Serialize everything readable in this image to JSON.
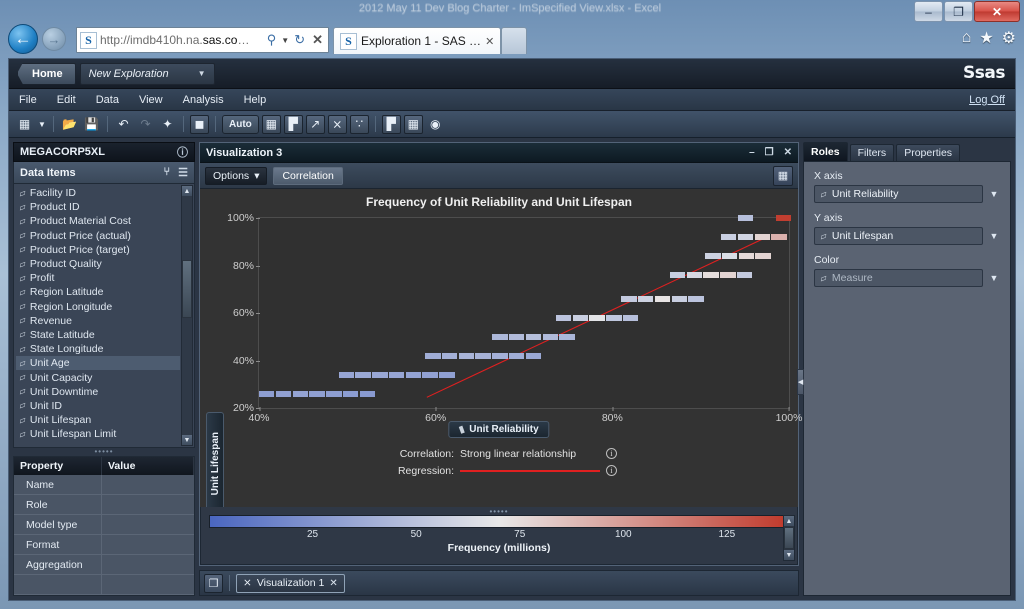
{
  "browser": {
    "ghost_title": "2012 May 11 Dev Blog Charter - ImSpecified View.xlsx - Excel",
    "window_buttons": {
      "minimize": "–",
      "maximize": "❐",
      "close": "✕"
    },
    "back_icon": "←",
    "forward_icon": "→",
    "site_icon": "S",
    "url_prefix": "http://imdb410h.na.",
    "url_bold": "sas.co",
    "url_suffix": "…",
    "search_icon": "⚲",
    "dropdown_icon": "▼",
    "refresh_icon": "↻",
    "stop_icon": "✕",
    "tab_label": "Exploration 1 - SAS …",
    "tab_close": "✕",
    "tools": [
      "⌂",
      "★",
      "⚙"
    ]
  },
  "app": {
    "home_label": "Home",
    "exploration_label": "New Exploration",
    "exploration_caret": "▼",
    "brand": "Ssas",
    "logoff": "Log Off",
    "menu": [
      "File",
      "Edit",
      "Data",
      "View",
      "Analysis",
      "Help"
    ],
    "toolbar": [
      {
        "name": "new-icon",
        "glyph": "▒",
        "framed": false
      },
      {
        "name": "new-dropdown-icon",
        "glyph": "▾",
        "framed": false
      },
      {
        "name": "sep1",
        "glyph": "",
        "framed": false
      },
      {
        "name": "open-icon",
        "glyph": "὜1",
        "framed": false
      },
      {
        "name": "save-icon",
        "glyph": "Ὃe",
        "framed": false
      },
      {
        "name": "sep2",
        "glyph": "",
        "framed": false
      },
      {
        "name": "undo-icon",
        "glyph": "↶",
        "framed": false
      },
      {
        "name": "redo-icon",
        "glyph": "↷",
        "framed": false
      },
      {
        "name": "refresh-data-icon",
        "glyph": "✦",
        "framed": false
      },
      {
        "name": "sep3",
        "glyph": "",
        "framed": false
      },
      {
        "name": "layout-icon",
        "glyph": "■",
        "framed": false
      },
      {
        "name": "sep4",
        "glyph": "",
        "framed": false
      },
      {
        "name": "auto-chart-button",
        "glyph": "Auto",
        "framed": false
      },
      {
        "name": "table-icon",
        "glyph": "▦",
        "framed": false
      },
      {
        "name": "bar-chart-icon",
        "glyph": "Ὄa",
        "framed": false
      },
      {
        "name": "line-chart-icon",
        "glyph": "↗",
        "framed": false
      },
      {
        "name": "scatter-icon",
        "glyph": "⨯",
        "framed": false
      },
      {
        "name": "bubble-icon",
        "glyph": "∴",
        "framed": false
      },
      {
        "name": "sep5",
        "glyph": "",
        "framed": false
      },
      {
        "name": "forecast-icon",
        "glyph": "⬚",
        "framed": true
      },
      {
        "name": "heatmap-icon",
        "glyph": "▦",
        "framed": true
      },
      {
        "name": "geo-map-icon",
        "glyph": "◉",
        "framed": false
      }
    ]
  },
  "left_panel": {
    "source_title": "MEGACORP5XL",
    "info_icon": "ⓘ",
    "data_items_label": "Data Items",
    "hierarchy_icon": "⑂",
    "filter_icon": "☰",
    "items": [
      "Facility ID",
      "Product ID",
      "Product Material Cost",
      "Product Price (actual)",
      "Product Price (target)",
      "Product Quality",
      "Profit",
      "Region Latitude",
      "Region Longitude",
      "Revenue",
      "State Latitude",
      "State Longitude",
      "Unit Age",
      "Unit Capacity",
      "Unit Downtime",
      "Unit ID",
      "Unit Lifespan",
      "Unit Lifespan Limit"
    ],
    "selected_item": "Unit Age",
    "scroll_up": "▲",
    "scroll_down": "▼",
    "grip": "•••••",
    "property_table": {
      "headers": [
        "Property",
        "Value"
      ],
      "rows": [
        {
          "property": "Name",
          "value": ""
        },
        {
          "property": "Role",
          "value": ""
        },
        {
          "property": "Model type",
          "value": ""
        },
        {
          "property": "Format",
          "value": ""
        },
        {
          "property": "Aggregation",
          "value": ""
        },
        {
          "property": "",
          "value": ""
        }
      ]
    }
  },
  "visualization": {
    "window_title": "Visualization 3",
    "minimize": "–",
    "maximize": "❐",
    "close": "✕",
    "options_label": "Options",
    "options_caret": "▾",
    "correlation_tab": "Correlation",
    "grid_icon": "▦",
    "x_axis_chip": "Unit Reliability",
    "y_axis_chip": "Unit Lifespan",
    "stats": {
      "correlation_label": "Correlation:",
      "correlation_value": "Strong linear relationship",
      "regression_label": "Regression:",
      "info_icon": "ⓘ"
    },
    "tab_bar": {
      "pages_icon": "❐",
      "tab_icon": "⨯",
      "tab_label": "Visualization 1",
      "tab_close": "✕"
    }
  },
  "right_panel": {
    "tabs": [
      "Roles",
      "Filters",
      "Properties"
    ],
    "active_tab": "Roles",
    "fields": [
      {
        "label": "X axis",
        "value": "Unit Reliability",
        "dim": false
      },
      {
        "label": "Y axis",
        "value": "Unit Lifespan",
        "dim": false
      },
      {
        "label": "Color",
        "value": "Measure",
        "dim": true
      }
    ],
    "caret": "▼",
    "collapse_icon": "◀"
  },
  "colors": {
    "accent_red": "#e02020",
    "legend_low": "#4a66c0",
    "legend_mid": "#e8e8e8",
    "legend_high": "#c0392b",
    "plot_bg": "#303030"
  },
  "chart_data": {
    "type": "heatmap",
    "title": "Frequency of Unit Reliability and Unit Lifespan",
    "xlabel": "Unit Reliability",
    "ylabel": "Unit Lifespan",
    "xlim": [
      40,
      100
    ],
    "ylim": [
      20,
      100
    ],
    "xticks": [
      "40%",
      "60%",
      "80%",
      "100%"
    ],
    "xtick_values": [
      40,
      60,
      80,
      100
    ],
    "yticks": [
      "20%",
      "40%",
      "60%",
      "80%",
      "100%"
    ],
    "ytick_values": [
      20,
      40,
      60,
      80,
      100
    ],
    "grid": false,
    "legend": {
      "position": "bottom",
      "caption": "Frequency (millions)",
      "ticks": [
        "25",
        "50",
        "75",
        "100",
        "125"
      ],
      "tick_values": [
        25,
        50,
        75,
        100,
        125
      ],
      "range": [
        0,
        140
      ],
      "low_color": "#4a66c0",
      "mid_color": "#e8e8e8",
      "high_color": "#c0392b"
    },
    "regression": {
      "color": "#e02020",
      "x0": 59.0,
      "y0": 24.5,
      "x1": 97.5,
      "y1": 92.0
    },
    "cells": [
      {
        "y": 26,
        "x_start": 40.0,
        "values": [
          {
            "x": 40.0,
            "freq": 30
          },
          {
            "x": 41.9,
            "freq": 32
          },
          {
            "x": 43.8,
            "freq": 33
          },
          {
            "x": 45.7,
            "freq": 31
          },
          {
            "x": 47.6,
            "freq": 30
          },
          {
            "x": 49.5,
            "freq": 29
          },
          {
            "x": 51.4,
            "freq": 28
          }
        ]
      },
      {
        "y": 34,
        "x_start": 49.0,
        "values": [
          {
            "x": 49.0,
            "freq": 34
          },
          {
            "x": 50.9,
            "freq": 36
          },
          {
            "x": 52.8,
            "freq": 35
          },
          {
            "x": 54.7,
            "freq": 34
          },
          {
            "x": 56.6,
            "freq": 33
          },
          {
            "x": 58.5,
            "freq": 32
          },
          {
            "x": 60.4,
            "freq": 31
          }
        ]
      },
      {
        "y": 42,
        "x_start": 58.8,
        "values": [
          {
            "x": 58.8,
            "freq": 38
          },
          {
            "x": 60.7,
            "freq": 40
          },
          {
            "x": 62.6,
            "freq": 42
          },
          {
            "x": 64.5,
            "freq": 41
          },
          {
            "x": 66.4,
            "freq": 40
          },
          {
            "x": 68.3,
            "freq": 38
          },
          {
            "x": 70.2,
            "freq": 36
          }
        ]
      },
      {
        "y": 50,
        "x_start": 66.4,
        "values": [
          {
            "x": 66.4,
            "freq": 44
          },
          {
            "x": 68.3,
            "freq": 46
          },
          {
            "x": 70.2,
            "freq": 48
          },
          {
            "x": 72.1,
            "freq": 45
          },
          {
            "x": 74.0,
            "freq": 43
          }
        ]
      },
      {
        "y": 58,
        "x_start": 73.6,
        "values": [
          {
            "x": 73.6,
            "freq": 50
          },
          {
            "x": 75.5,
            "freq": 56
          },
          {
            "x": 77.4,
            "freq": 68
          },
          {
            "x": 79.3,
            "freq": 52
          },
          {
            "x": 81.2,
            "freq": 48
          }
        ]
      },
      {
        "y": 66,
        "x_start": 81.0,
        "values": [
          {
            "x": 81.0,
            "freq": 54
          },
          {
            "x": 82.9,
            "freq": 58
          },
          {
            "x": 84.8,
            "freq": 72
          },
          {
            "x": 86.7,
            "freq": 56
          },
          {
            "x": 88.6,
            "freq": 50
          }
        ]
      },
      {
        "y": 76,
        "x_start": 86.5,
        "values": [
          {
            "x": 86.5,
            "freq": 56
          },
          {
            "x": 88.4,
            "freq": 62
          },
          {
            "x": 90.3,
            "freq": 74
          },
          {
            "x": 92.2,
            "freq": 78
          },
          {
            "x": 94.1,
            "freq": 54
          }
        ]
      },
      {
        "y": 84,
        "x_start": 90.5,
        "values": [
          {
            "x": 90.5,
            "freq": 58
          },
          {
            "x": 92.4,
            "freq": 64
          },
          {
            "x": 94.3,
            "freq": 76
          },
          {
            "x": 96.2,
            "freq": 78
          }
        ]
      },
      {
        "y": 92,
        "x_start": 92.3,
        "values": [
          {
            "x": 92.3,
            "freq": 56
          },
          {
            "x": 94.2,
            "freq": 60
          },
          {
            "x": 96.1,
            "freq": 78
          },
          {
            "x": 98.0,
            "freq": 92
          }
        ]
      },
      {
        "y": 100,
        "x_start": 94.2,
        "values": [
          {
            "x": 94.2,
            "freq": 48
          },
          {
            "x": 98.5,
            "freq": 138
          }
        ]
      }
    ]
  }
}
